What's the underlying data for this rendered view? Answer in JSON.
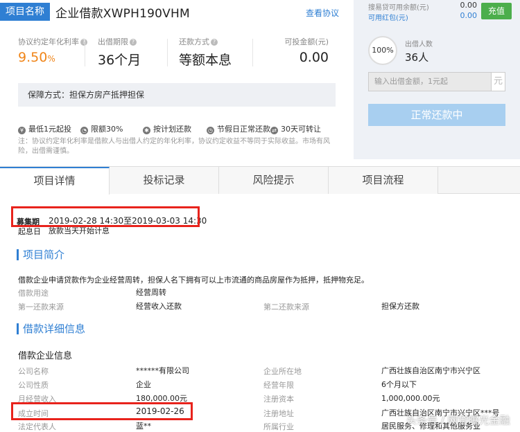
{
  "header": {
    "tag": "项目名称",
    "title": "企业借款XWPH190VHM",
    "agreement_link": "查看协议"
  },
  "metrics": [
    {
      "label": "协议约定年化利率",
      "value": "9.50",
      "unit": "%"
    },
    {
      "label": "出借期限",
      "value": "36个月"
    },
    {
      "label": "还款方式",
      "value": "等额本息"
    },
    {
      "label": "可投金额(元)",
      "value": "0.00"
    }
  ],
  "guarantee": "保障方式：担保方房产抵押担保",
  "features": [
    "最低1元起投",
    "限额30%",
    "按计划还款",
    "节假日正常还款",
    "30天可转让"
  ],
  "note": "注：协议约定年化利率是借款人与出借人约定的年化利率，协议约定收益不等同于实际收益。市场有风险，出借需谨慎。",
  "right_panel": {
    "available_label": "搜易贷可用余额(元)",
    "available_value": "0.00",
    "redpacket_label": "可用红包(元)",
    "redpacket_value": "0.00",
    "recharge_label": "充值",
    "progress_text": "100%",
    "progress": 1.0,
    "lenders_label": "出借人数",
    "lenders_value": "36人",
    "amount_placeholder": "输入出借金额，1元起",
    "amount_unit": "元",
    "status_button": "正常还款中"
  },
  "tabs": [
    "项目详情",
    "投标记录",
    "风险提示",
    "项目流程"
  ],
  "raise": {
    "label": "募集期",
    "value": "2019-02-28 14:30至2019-03-03 14:30",
    "interest_label": "起息日",
    "interest_value": "放款当天开始计息"
  },
  "intro": {
    "title": "项目简介",
    "description": "借款企业申请贷款作为企业经营周转，担保人名下拥有可以上市流通的商品房屋作为抵押，抵押物充足。",
    "purpose_label": "借款用途",
    "purpose_value": "经营周转",
    "source1_label": "第一还款来源",
    "source1_value": "经营收入还款",
    "source2_label": "第二还款来源",
    "source2_value": "担保方还款"
  },
  "detail": {
    "title": "借款详细信息",
    "subtitle": "借款企业信息",
    "rows": [
      {
        "k1": "公司名称",
        "v1": "******有限公司",
        "k2": "企业所在地",
        "v2": "广西壮族自治区南宁市兴宁区"
      },
      {
        "k1": "公司性质",
        "v1": "企业",
        "k2": "经营年限",
        "v2": "6个月以下"
      },
      {
        "k1": "月经营收入",
        "v1": "180,000.00元",
        "k2": "注册资本",
        "v2": "1,000,000.00元"
      },
      {
        "k1": "成立时间",
        "v1": "2019-02-26",
        "k2": "注册地址",
        "v2": "广西壮族自治区南宁市兴宁区***号"
      },
      {
        "k1": "法定代表人",
        "v1": "蓝**",
        "k2": "所属行业",
        "v2": "居民服务、修理和其他服务业"
      }
    ]
  },
  "watermark": "头条号 / 网贷曝光金融"
}
